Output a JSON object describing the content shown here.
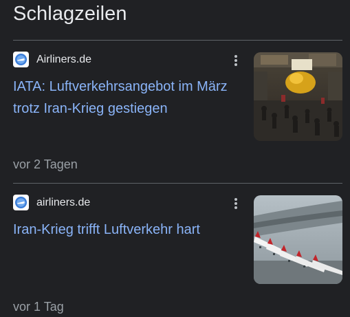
{
  "section": {
    "title": "Schlagzeilen"
  },
  "articles": [
    {
      "source": "Airliners.de",
      "headline": "IATA: Luftverkehrsangebot im März trotz Iran-Krieg gestiegen",
      "time": "vor 2 Tagen",
      "icon": "airliners-logo-icon"
    },
    {
      "source": "airliners.de",
      "headline": "Iran-Krieg trifft Luftverkehr hart",
      "time": "vor 1 Tag",
      "icon": "airliners-logo-icon"
    }
  ],
  "colors": {
    "background": "#202124",
    "headline": "#8ab4f8",
    "text": "#e8eaed",
    "muted": "#9aa0a6",
    "divider": "#5f6368"
  }
}
